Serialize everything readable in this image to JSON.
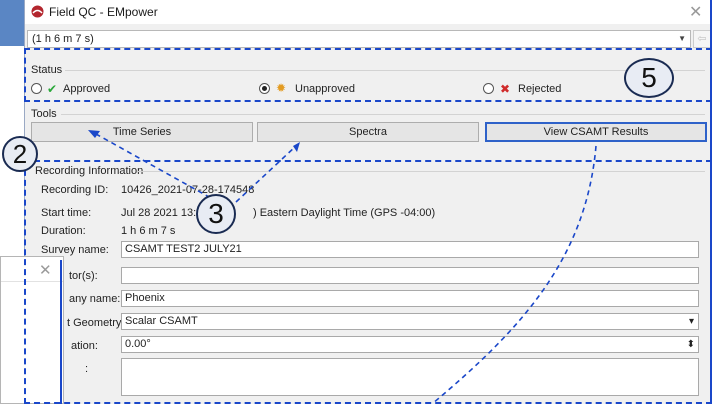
{
  "window": {
    "title": "Field QC - EMpower",
    "close_glyph": "✕"
  },
  "recording_selector": {
    "value": "(1 h 6 m 7 s)",
    "arrow_glyph": "▼",
    "prev_glyph": "⇦",
    "next_glyph": "➡"
  },
  "status": {
    "label": "Status",
    "options": [
      {
        "label": "Approved",
        "icon": "check-icon",
        "color": "#2aa83a",
        "glyph": "✔",
        "selected": false
      },
      {
        "label": "Unapproved",
        "icon": "warning-icon",
        "color": "#e39b21",
        "glyph": "✹",
        "selected": true
      },
      {
        "label": "Rejected",
        "icon": "x-icon",
        "color": "#d02b2b",
        "glyph": "✖",
        "selected": false
      }
    ]
  },
  "tools": {
    "label": "Tools",
    "buttons": [
      "Time Series",
      "Spectra",
      "View CSAMT Results"
    ]
  },
  "recording_info": {
    "label": "Recording Information",
    "recording_id_label": "Recording ID:",
    "recording_id": "10426_2021-07-28-174548",
    "start_time_label": "Start time:",
    "start_time_a": "Jul 28 2021 13:4",
    "start_time_b": ") Eastern Daylight Time (GPS -04:00)",
    "duration_label": "Duration:",
    "duration": "1 h 6 m 7 s",
    "survey_name_label": "Survey name:",
    "survey_name": "CSAMT TEST2 JULY21",
    "operators_label": "tor(s):",
    "operators": "",
    "company_label": "any name:",
    "company": "Phoenix",
    "geometry_label": "t Geometry:",
    "geometry": "Scalar CSAMT",
    "geometry_arrow": "▾",
    "declination_label": "ation:",
    "declination": "0.00°",
    "spin_glyph": "⬍",
    "notes_label": ":"
  },
  "callouts": {
    "two": "2",
    "three": "3",
    "five": "5"
  },
  "subdialog": {
    "close_glyph": "✕"
  },
  "colors": {
    "annotation_blue": "#1a47c9",
    "dialog_bg": "#f0f0f0"
  }
}
